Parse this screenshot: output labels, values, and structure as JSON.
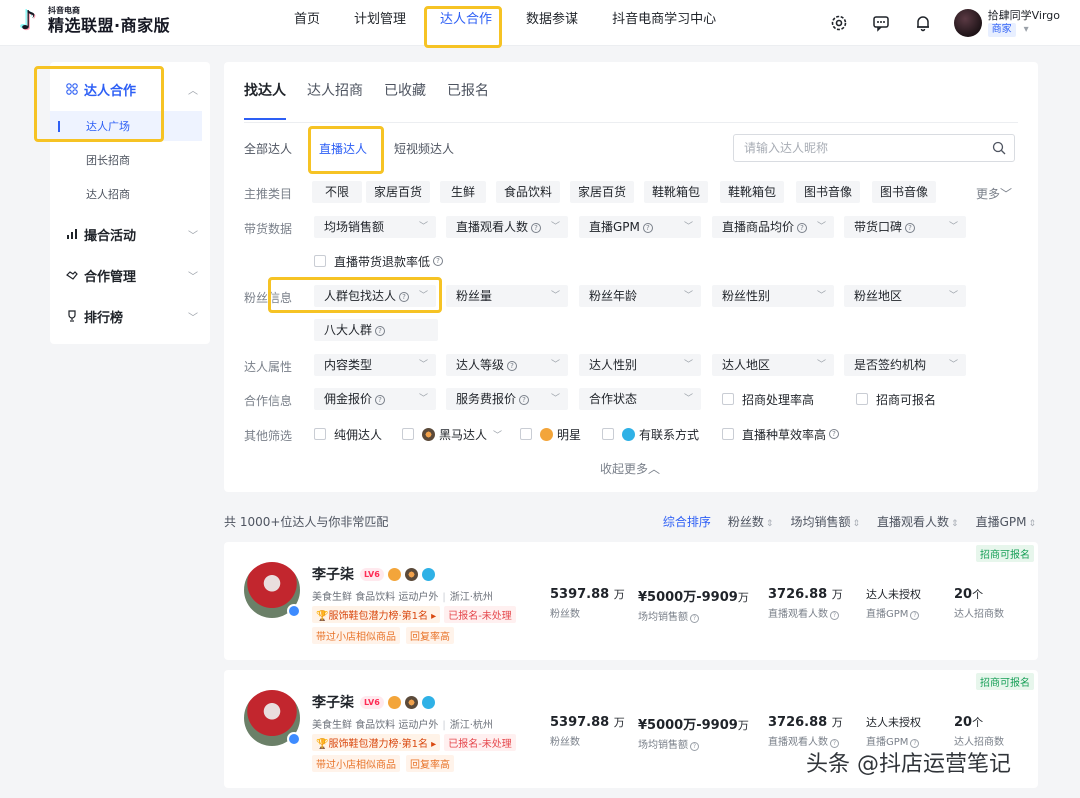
{
  "brand": {
    "sub": "抖音电商",
    "main": "精选联盟·商家版"
  },
  "nav": {
    "items": [
      "首页",
      "计划管理",
      "达人合作",
      "数据参谋",
      "抖音电商学习中心"
    ],
    "active_index": 2
  },
  "user": {
    "name": "拾肆同学Virgo",
    "role": "商家"
  },
  "sidebar": {
    "groups": [
      {
        "label": "达人合作",
        "icon": "grid-icon",
        "expanded": true,
        "items": [
          {
            "label": "达人广场"
          },
          {
            "label": "团长招商"
          },
          {
            "label": "达人招商"
          }
        ]
      },
      {
        "label": "撮合活动",
        "icon": "bar-chart-icon"
      },
      {
        "label": "合作管理",
        "icon": "handshake-icon"
      },
      {
        "label": "排行榜",
        "icon": "trophy-icon"
      }
    ]
  },
  "main": {
    "tabs": [
      "找达人",
      "达人招商",
      "已收藏",
      "已报名"
    ],
    "subtabs": [
      "全部达人",
      "直播达人",
      "短视频达人"
    ],
    "search_placeholder": "请输入达人昵称",
    "rows": {
      "category": {
        "label": "主推类目",
        "chips": [
          "不限",
          "家居百货",
          "生鲜",
          "食品饮料",
          "家居百货",
          "鞋靴箱包",
          "鞋靴箱包",
          "图书音像",
          "图书音像"
        ],
        "more": "更多"
      },
      "sales": {
        "label": "带货数据",
        "dropdowns": [
          "均场销售额",
          "直播观看人数",
          "直播GPM",
          "直播商品均价",
          "带货口碑"
        ],
        "checkbox": "直播带货退款率低"
      },
      "fans": {
        "label": "粉丝信息",
        "dropdowns": [
          "人群包找达人",
          "粉丝量",
          "粉丝年龄",
          "粉丝性别",
          "粉丝地区",
          "八大人群"
        ]
      },
      "attr": {
        "label": "达人属性",
        "dropdowns": [
          "内容类型",
          "达人等级",
          "达人性别",
          "达人地区",
          "是否签约机构"
        ]
      },
      "coop": {
        "label": "合作信息",
        "dropdowns": [
          "佣金报价",
          "服务费报价",
          "合作状态"
        ],
        "checkboxes": [
          "招商处理率高",
          "招商可报名"
        ]
      },
      "other": {
        "label": "其他筛选",
        "checkboxes": [
          "纯佣达人",
          "黑马达人",
          "明星",
          "有联系方式",
          "直播种草效率高"
        ]
      }
    },
    "collapse_label": "收起更多"
  },
  "results": {
    "count_text": "共 1000+位达人与你非常匹配",
    "sorts": [
      "综合排序",
      "粉丝数",
      "场均销售额",
      "直播观看人数",
      "直播GPM"
    ],
    "cards": [
      {
        "tag": "招商可报名",
        "name": "李子柒",
        "level": "LV6",
        "cats": [
          "美食生鲜",
          "食品饮料",
          "运动户外"
        ],
        "location": "浙江·杭州",
        "rank": "服饰鞋包潜力榜·第1名",
        "status": "已报名-未处理",
        "tags": [
          "带过小店相似商品",
          "回复率高"
        ],
        "fans": {
          "value": "5397.88",
          "unit": "万",
          "label": "粉丝数"
        },
        "sales": {
          "value": "¥5000万-9909",
          "unit": "万",
          "label": "场均销售额"
        },
        "viewers": {
          "value": "3726.88",
          "unit": "万",
          "label": "直播观看人数"
        },
        "gpm": {
          "value": "达人未授权",
          "label": "直播GPM"
        },
        "recruit": {
          "value": "20",
          "unit": "个",
          "label": "达人招商数"
        }
      },
      {
        "tag": "招商可报名",
        "name": "李子柒",
        "level": "LV6",
        "cats": [
          "美食生鲜",
          "食品饮料",
          "运动户外"
        ],
        "location": "浙江·杭州",
        "rank": "服饰鞋包潜力榜·第1名",
        "status": "已报名-未处理",
        "tags": [
          "带过小店相似商品",
          "回复率高"
        ],
        "fans": {
          "value": "5397.88",
          "unit": "万",
          "label": "粉丝数"
        },
        "sales": {
          "value": "¥5000万-9909",
          "unit": "万",
          "label": "场均销售额"
        },
        "viewers": {
          "value": "3726.88",
          "unit": "万",
          "label": "直播观看人数"
        },
        "gpm": {
          "value": "达人未授权",
          "label": "直播GPM"
        },
        "recruit": {
          "value": "20",
          "unit": "个",
          "label": "达人招商数"
        }
      }
    ]
  },
  "watermark": "头条 @抖店运营笔记",
  "colors": {
    "accent": "#2d5ff5",
    "highlight": "#f6c324",
    "success": "#18a058"
  }
}
